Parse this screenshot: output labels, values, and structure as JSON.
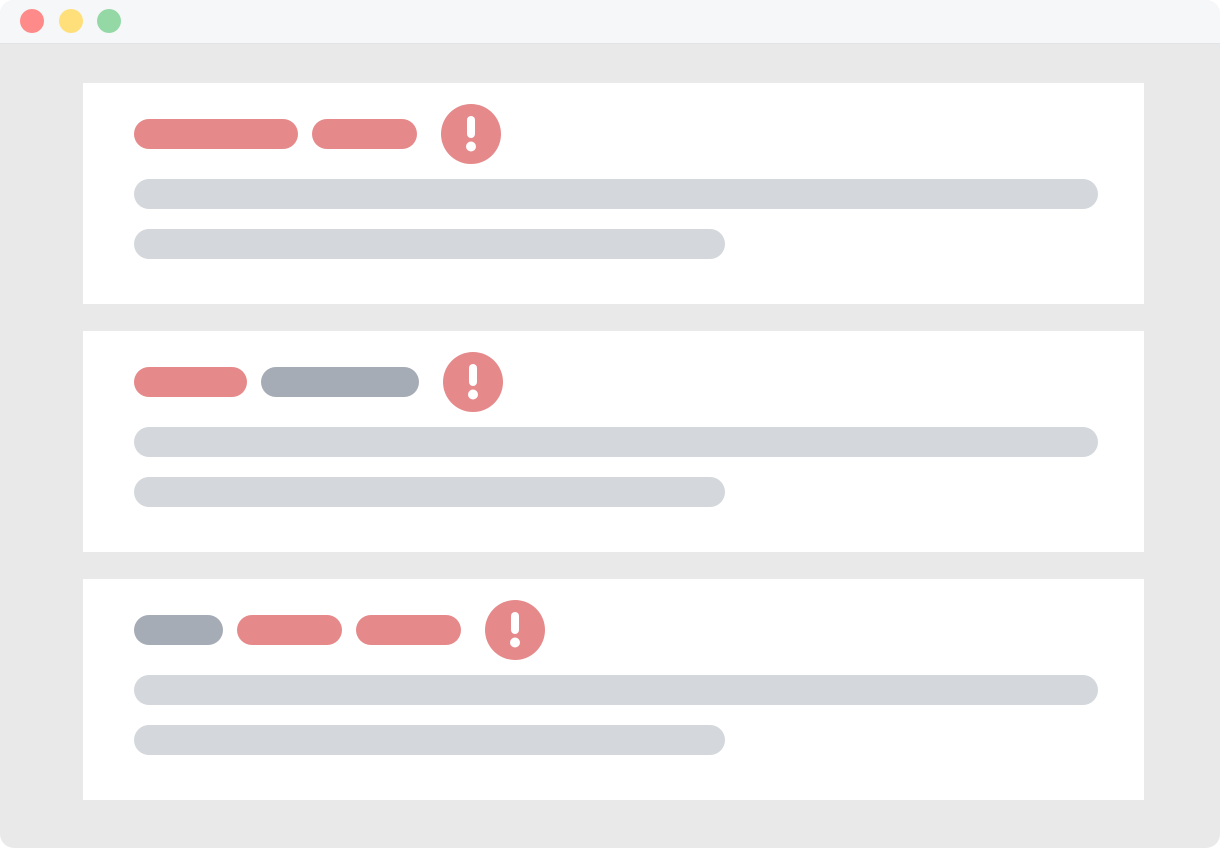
{
  "colors": {
    "window_bg": "#e9e9e9",
    "titlebar_bg": "#f6f7f8",
    "card_bg": "#ffffff",
    "error_tag": "#e6898a",
    "neutral_tag": "#a6acb6",
    "text_placeholder": "#d4d7db",
    "alert_bg": "#e6898a",
    "alert_glyph": "#ffffff"
  },
  "window_controls": {
    "close_color": "#ff8a8a",
    "minimize_color": "#ffdf7a",
    "maximize_color": "#94d8a6"
  },
  "cards": [
    {
      "tags": [
        {
          "kind": "error-tag",
          "color": "#e6898a"
        },
        {
          "kind": "error-tag",
          "color": "#e6898a"
        }
      ],
      "alert_icon": "exclamation-circle-icon"
    },
    {
      "tags": [
        {
          "kind": "error-tag",
          "color": "#e6898a"
        },
        {
          "kind": "neutral-tag",
          "color": "#a6acb6"
        }
      ],
      "alert_icon": "exclamation-circle-icon"
    },
    {
      "tags": [
        {
          "kind": "neutral-tag",
          "color": "#a6acb6"
        },
        {
          "kind": "error-tag",
          "color": "#e6898a"
        },
        {
          "kind": "error-tag",
          "color": "#e6898a"
        }
      ],
      "alert_icon": "exclamation-circle-icon"
    }
  ]
}
